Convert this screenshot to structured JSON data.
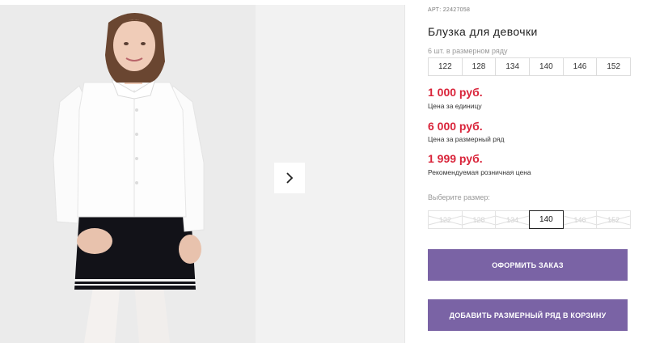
{
  "product": {
    "article": "АРТ: 22427058",
    "title": "Блузка для девочки"
  },
  "size_row": {
    "label": "6 шт. в размерном ряду",
    "sizes": [
      "122",
      "128",
      "134",
      "140",
      "146",
      "152"
    ]
  },
  "prices": [
    {
      "value": "1 000 руб.",
      "caption": "Цена за единицу"
    },
    {
      "value": "6 000 руб.",
      "caption": "Цена за размерный ряд"
    },
    {
      "value": "1 999 руб.",
      "caption": "Рекомендуемая розничная цена"
    }
  ],
  "size_select": {
    "label": "Выберите размер:",
    "options": [
      "122",
      "128",
      "134",
      "140",
      "146",
      "152"
    ],
    "selected": "140"
  },
  "buttons": {
    "order": "ОФОРМИТЬ ЗАКАЗ",
    "add_row": "ДОБАВИТЬ РАЗМЕРНЫЙ РЯД В КОРЗИНУ"
  },
  "gallery": {
    "next_icon": "chevron-right-icon"
  },
  "colors": {
    "price": "#d9243a",
    "button": "#7a63a5"
  }
}
